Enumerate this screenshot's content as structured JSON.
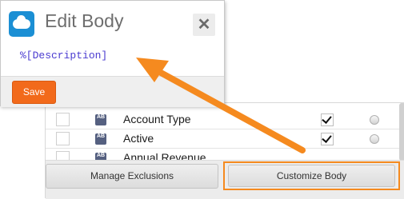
{
  "dialog": {
    "title": "Edit Body",
    "close_symbol": "✕",
    "body_text": "%[Description]",
    "save_label": "Save",
    "logo_icon": "salesforce-cloud-icon"
  },
  "fields": {
    "rows": [
      {
        "type_icon": "AB",
        "label": "Account Type",
        "included": true
      },
      {
        "type_icon": "AB",
        "label": "Active",
        "included": true
      },
      {
        "type_icon": "AB",
        "label": "Annual Revenue",
        "included": false
      }
    ]
  },
  "buttons": {
    "manage_exclusions": "Manage Exclusions",
    "customize_body": "Customize Body"
  },
  "colors": {
    "accent_orange": "#f58a1f",
    "save_button": "#f26a1b",
    "code_text": "#4a3bd0"
  }
}
